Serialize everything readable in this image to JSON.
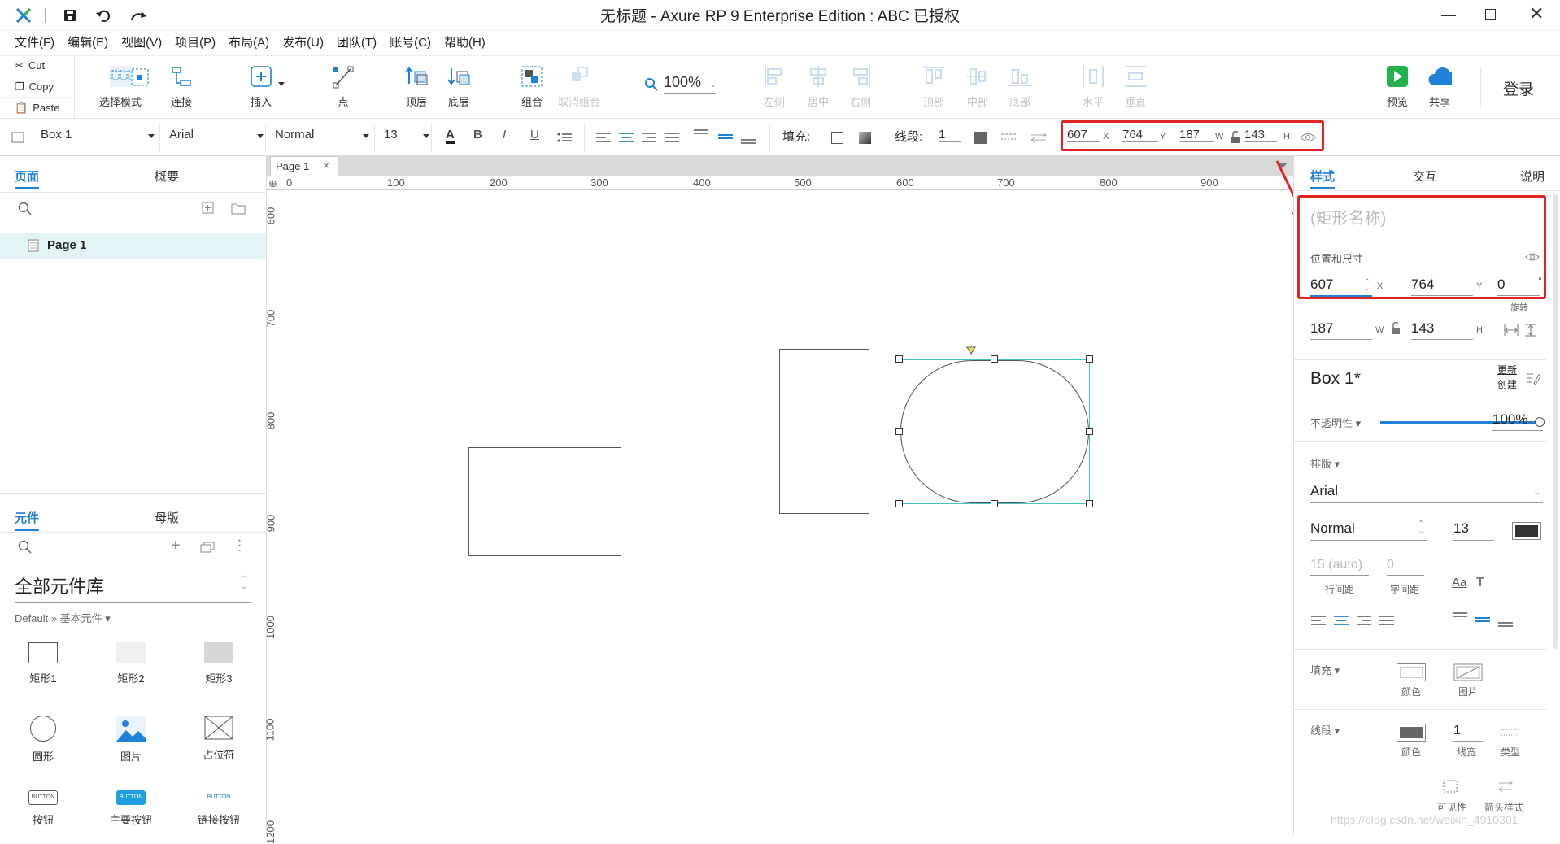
{
  "app": {
    "title": "无标题 - Axure RP 9 Enterprise Edition : ABC 已授权",
    "brand_color": "#1f82d6",
    "highlight_color": "#e02424"
  },
  "menu": [
    "文件(F)",
    "编辑(E)",
    "视图(V)",
    "项目(P)",
    "布局(A)",
    "发布(U)",
    "团队(T)",
    "账号(C)",
    "帮助(H)"
  ],
  "clipboard": {
    "cut": "Cut",
    "copy": "Copy",
    "paste": "Paste"
  },
  "toolbar": {
    "select_mode": "选择模式",
    "connect": "连接",
    "insert": "插入",
    "point": "点",
    "top": "顶层",
    "bottom": "底层",
    "group": "组合",
    "ungroup": "取消组合",
    "zoom": "100%",
    "align_left": "左侧",
    "align_center": "居中",
    "align_right": "右侧",
    "align_top": "顶部",
    "align_middle": "中部",
    "align_bottom": "底部",
    "dist_h": "水平",
    "dist_v": "垂直",
    "preview": "预览",
    "share": "共享",
    "login": "登录"
  },
  "format": {
    "widget": "Box 1",
    "font": "Arial",
    "weight": "Normal",
    "size": "13",
    "fill_label": "填充:",
    "stroke_label": "线段:",
    "stroke_width": "1",
    "x": "607",
    "x_label": "X",
    "y": "764",
    "y_label": "Y",
    "w": "187",
    "w_label": "W",
    "h": "143",
    "h_label": "H"
  },
  "left": {
    "tab_pages": "页面",
    "tab_outline": "概要",
    "page_item": "Page 1",
    "tab_widgets": "元件",
    "tab_masters": "母版",
    "library": "全部元件库",
    "breadcrumb": "Default » 基本元件 ▾",
    "components": [
      {
        "label": "矩形1",
        "icon": "rectangle1-icon"
      },
      {
        "label": "矩形2",
        "icon": "rectangle2-icon"
      },
      {
        "label": "矩形3",
        "icon": "rectangle3-icon"
      },
      {
        "label": "圆形",
        "icon": "circle-icon"
      },
      {
        "label": "图片",
        "icon": "image-icon"
      },
      {
        "label": "占位符",
        "icon": "placeholder-icon"
      },
      {
        "label": "按钮",
        "icon": "button-icon"
      },
      {
        "label": "主要按钮",
        "icon": "primary-button-icon"
      },
      {
        "label": "链接按钮",
        "icon": "link-button-icon"
      }
    ]
  },
  "canvas": {
    "tab": "Page 1",
    "ruler_h": [
      "0",
      "100",
      "200",
      "300",
      "400",
      "500",
      "600",
      "700",
      "800",
      "900"
    ],
    "ruler_v": [
      "600",
      "700",
      "800",
      "900",
      "1000",
      "1100",
      "1200"
    ]
  },
  "right": {
    "tab_style": "样式",
    "tab_interaction": "交互",
    "tab_notes": "说明",
    "shape_name_placeholder": "(矩形名称)",
    "pos_title": "位置和尺寸",
    "x": "607",
    "x_label": "X",
    "y": "764",
    "y_label": "Y",
    "rotation": "0",
    "rotation_unit": "°",
    "rotation_label": "旋转",
    "w": "187",
    "w_label": "W",
    "h": "143",
    "h_label": "H",
    "style_name": "Box 1*",
    "update_label": "更新",
    "create_label": "创建",
    "opacity_label": "不透明性 ▾",
    "opacity_value": "100%",
    "opacity_level": 1.0,
    "typography_label": "排版 ▾",
    "font": "Arial",
    "weight": "Normal",
    "size": "13",
    "line_height": "15 (auto)",
    "line_height_label": "行间距",
    "letter_spacing": "0",
    "letter_spacing_label": "字间距",
    "fill_label": "填充 ▾",
    "fill_color_label": "颜色",
    "fill_image_label": "图片",
    "stroke_label": "线段 ▾",
    "stroke_color_label": "颜色",
    "stroke_width": "1",
    "stroke_width_label": "线宽",
    "stroke_type_label": "类型",
    "visibility_label": "可见性",
    "arrow_label": "箭头样式"
  },
  "watermark": "https://blog.csdn.net/weixin_4910301"
}
